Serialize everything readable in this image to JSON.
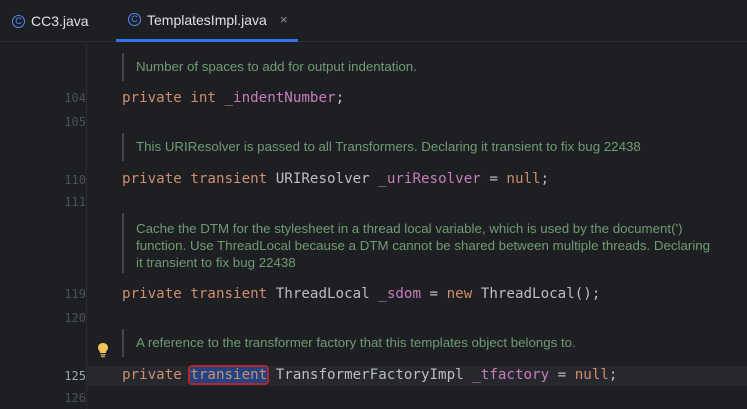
{
  "tabs": [
    {
      "label": "CC3.java",
      "icon": "class-icon",
      "icon_glyph": "C",
      "active": false
    },
    {
      "label": "TemplatesImpl.java",
      "icon": "class-icon",
      "icon_glyph": "C",
      "active": true,
      "close": "×"
    }
  ],
  "accent_color": "#3574f0",
  "lines": {
    "ln104": "104",
    "ln105": "105",
    "ln110": "110",
    "ln111": "111",
    "ln119": "119",
    "ln120": "120",
    "ln125": "125",
    "ln126": "126"
  },
  "docs": {
    "d1": "Number of spaces to add for output indentation.",
    "d2": "This URIResolver is passed to all Transformers. Declaring it transient to fix bug 22438",
    "d3a": "Cache the DTM for the stylesheet in a thread local variable, which is used by the document(')",
    "d3b": "function. Use ThreadLocal because a DTM cannot be shared between multiple threads. Declaring",
    "d3c": "it transient to fix bug 22438",
    "d4": "A reference to the transformer factory that this templates object belongs to."
  },
  "code": {
    "l104": {
      "kw1": "private",
      "kw2": "int",
      "field": "_indentNumber",
      "end": ";"
    },
    "l110": {
      "kw1": "private",
      "kw2": "transient",
      "type": "URIResolver",
      "field": "_uriResolver",
      "eq": " = ",
      "kw3": "null",
      "end": ";"
    },
    "l119": {
      "kw1": "private",
      "kw2": "transient",
      "type": "ThreadLocal",
      "field": "_sdom",
      "eq": " = ",
      "kw3": "new",
      "rest": " ThreadLocal();"
    },
    "l125": {
      "kw1": "private",
      "kw2": "transient",
      "type": "TransformerFactoryImpl",
      "field": "_tfactory",
      "eq": " = ",
      "kw3": "null",
      "end": ";"
    }
  },
  "intention_icon": "lightbulb-icon"
}
